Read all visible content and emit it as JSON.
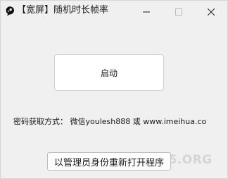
{
  "window": {
    "title": "【宽屏】随机时长帧率"
  },
  "controls": {
    "minimize_icon": "minimize-icon",
    "maximize_icon": "maximize-icon",
    "close_icon": "close-icon"
  },
  "main": {
    "start_label": "启动",
    "password_text": "密码获取方式： 微信youlesh888 或 www.imeihua.co",
    "restart_label": "以管理员身份重新打开程序"
  },
  "watermark": {
    "text": "W.A5.ORG"
  },
  "colors": {
    "window_bg": "#f0f0f0",
    "button_bg": "#ffffff",
    "text": "#1a1a1a"
  }
}
